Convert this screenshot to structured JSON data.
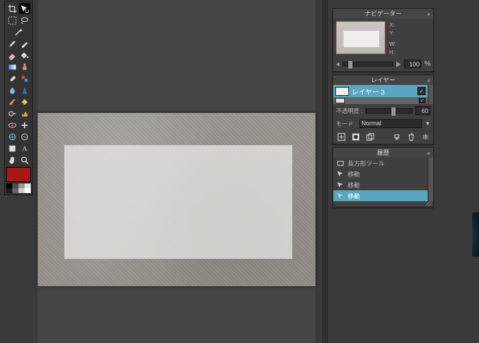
{
  "navigator": {
    "title": "ナビゲーター",
    "coords": {
      "x_label": "X:",
      "y_label": "Y:",
      "w_label": "W:",
      "h_label": "H:"
    },
    "zoom_value": "100",
    "zoom_suffix": "%"
  },
  "layers": {
    "title": "レイヤー",
    "active_layer_name": "レイヤー 3",
    "opacity_label": "不透明度 :",
    "opacity_value": "60",
    "mode_label": "モード :",
    "mode_value": "Normal"
  },
  "history": {
    "title": "履歴",
    "items": [
      {
        "label": "長方形ツール"
      },
      {
        "label": "移動"
      },
      {
        "label": "移動"
      },
      {
        "label": "移動"
      }
    ],
    "current_index": 3
  },
  "colors": {
    "foreground": "#a81818",
    "swatches": [
      "#000000",
      "#333333",
      "#666666",
      "#999999",
      "#cccccc",
      "#ffffff",
      "#000000",
      "#ffffff"
    ]
  }
}
